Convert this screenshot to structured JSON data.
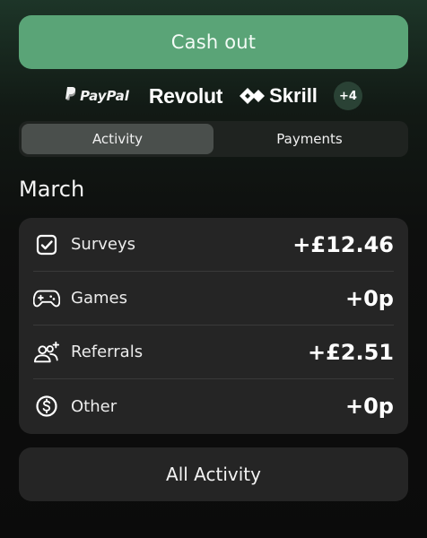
{
  "cashout": {
    "label": "Cash out"
  },
  "providers": {
    "paypal": "PayPal",
    "revolut": "Revolut",
    "skrill": "Skrill",
    "more": "+4"
  },
  "tabs": [
    {
      "label": "Activity",
      "active": true
    },
    {
      "label": "Payments",
      "active": false
    }
  ],
  "month": "March",
  "earnings": [
    {
      "label": "Surveys",
      "amount": "+£12.46",
      "icon": "checkbox-icon"
    },
    {
      "label": "Games",
      "amount": "+0p",
      "icon": "gamepad-icon"
    },
    {
      "label": "Referrals",
      "amount": "+£2.51",
      "icon": "referrals-icon"
    },
    {
      "label": "Other",
      "amount": "+0p",
      "icon": "dollar-circle-icon"
    }
  ],
  "all_activity": {
    "label": "All Activity"
  },
  "colors": {
    "accent": "#5aa477",
    "card": "#252525",
    "badge": "#2a4235"
  }
}
